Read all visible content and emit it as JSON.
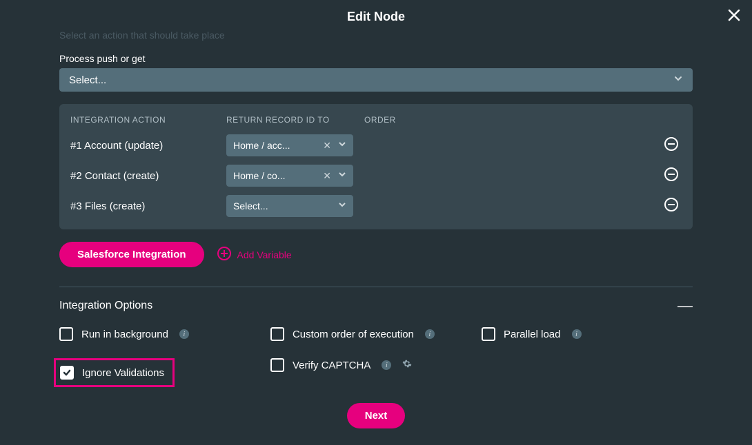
{
  "header": {
    "title": "Edit Node"
  },
  "subtitle": "Select an action that should take place",
  "processLabel": "Process push or get",
  "processSelect": "Select...",
  "table": {
    "headers": {
      "action": "INTEGRATION ACTION",
      "return": "RETURN RECORD ID TO",
      "order": "ORDER"
    },
    "rows": [
      {
        "label": "#1 Account (update)",
        "return": "Home / acc..."
      },
      {
        "label": "#2 Contact (create)",
        "return": "Home / co..."
      },
      {
        "label": "#3 Files (create)",
        "return": "Select..."
      }
    ]
  },
  "salesforceBtn": "Salesforce Integration",
  "addVariable": "Add Variable",
  "integrationOptions": "Integration Options",
  "options": {
    "runBg": "Run in background",
    "customOrder": "Custom order of execution",
    "parallel": "Parallel load",
    "ignoreValidations": "Ignore Validations",
    "verifyCaptcha": "Verify CAPTCHA"
  },
  "nextBtn": "Next"
}
